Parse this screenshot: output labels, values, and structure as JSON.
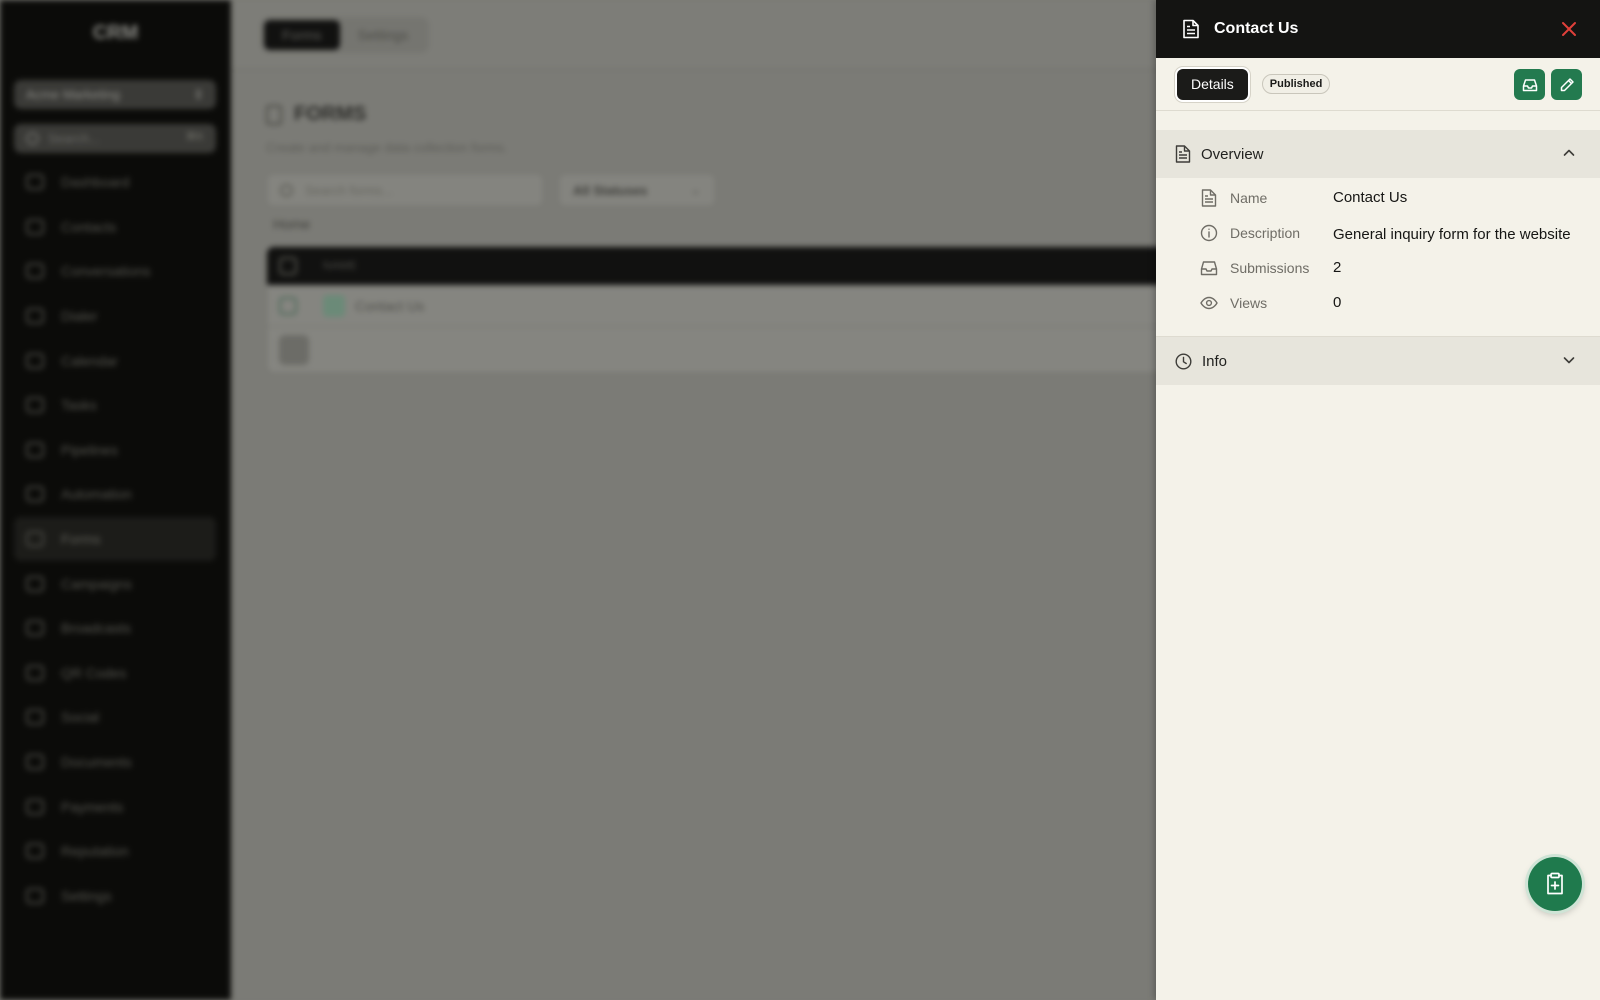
{
  "background": {
    "brand": "CRM",
    "org_select": "Acme Marketing",
    "search_placeholder": "Search...",
    "search_shortcut": "⌘K",
    "nav": [
      "Dashboard",
      "Contacts",
      "Conversations",
      "Dialer",
      "Calendar",
      "Tasks",
      "Pipelines",
      "Automation",
      "Forms",
      "Campaigns",
      "Broadcasts",
      "QR Codes",
      "Social",
      "Documents",
      "Payments",
      "Reputation",
      "Settings"
    ],
    "active_nav": "Forms",
    "tabs": [
      "Forms",
      "Settings"
    ],
    "page_title": "FORMS",
    "page_subtitle": "Create and manage data collection forms.",
    "forms_search_placeholder": "Search forms...",
    "status_filter": "All Statuses",
    "breadcrumb": "Home",
    "table_header_name": "NAME",
    "rows": [
      {
        "name": "Contact Us"
      }
    ]
  },
  "drawer": {
    "title": "Contact Us",
    "tab_details": "Details",
    "status_badge": "Published",
    "overview": {
      "label": "Overview",
      "fields": [
        {
          "label": "Name",
          "value": "Contact Us",
          "icon": "document-icon"
        },
        {
          "label": "Description",
          "value": "General inquiry form for the website",
          "icon": "info-circle-icon"
        },
        {
          "label": "Submissions",
          "value": "2",
          "icon": "inbox-icon"
        },
        {
          "label": "Views",
          "value": "0",
          "icon": "eye-icon"
        }
      ]
    },
    "info": {
      "label": "Info"
    }
  },
  "colors": {
    "accent_green": "#237a4f",
    "close_red": "#e0403a",
    "header_dark": "#141412",
    "drawer_bg": "#f4f2e9"
  }
}
